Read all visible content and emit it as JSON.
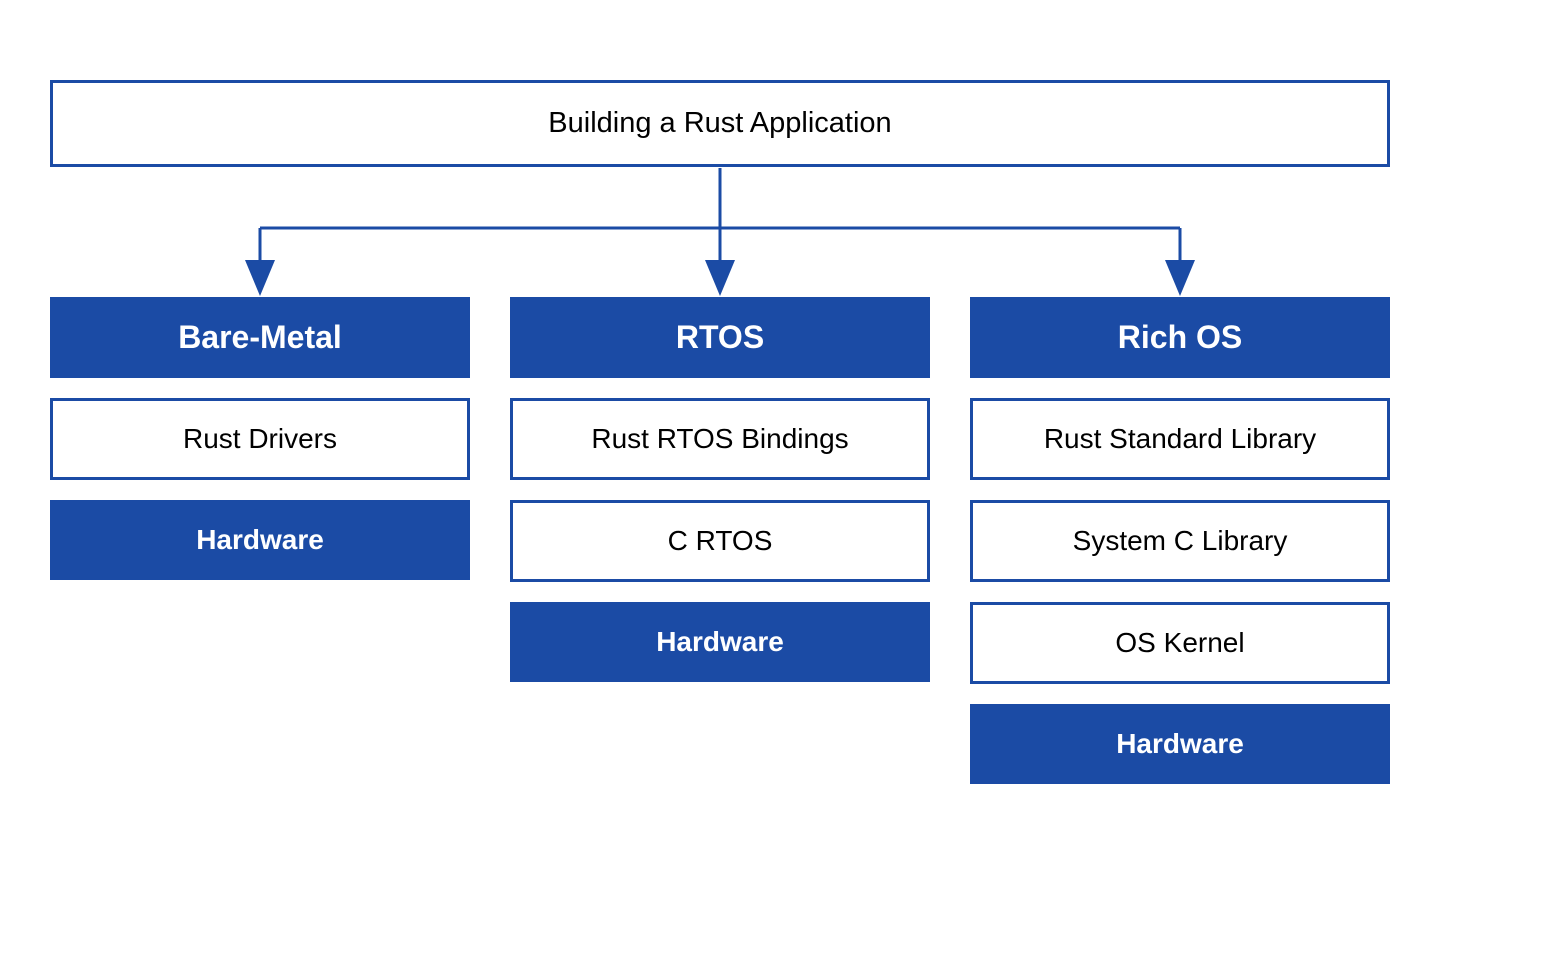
{
  "title": "Building a Rust Application",
  "columns": [
    {
      "header": "Bare-Metal",
      "layers": [
        {
          "label": "Rust Drivers",
          "type": "outlined"
        },
        {
          "label": "Hardware",
          "type": "hardware"
        }
      ]
    },
    {
      "header": "RTOS",
      "layers": [
        {
          "label": "Rust RTOS Bindings",
          "type": "outlined"
        },
        {
          "label": "C RTOS",
          "type": "outlined"
        },
        {
          "label": "Hardware",
          "type": "hardware"
        }
      ]
    },
    {
      "header": "Rich OS",
      "layers": [
        {
          "label": "Rust Standard Library",
          "type": "outlined"
        },
        {
          "label": "System C Library",
          "type": "outlined"
        },
        {
          "label": "OS Kernel",
          "type": "outlined"
        },
        {
          "label": "Hardware",
          "type": "hardware"
        }
      ]
    }
  ],
  "colors": {
    "primary": "#1B4BA5",
    "background": "#ffffff",
    "text": "#000000"
  }
}
